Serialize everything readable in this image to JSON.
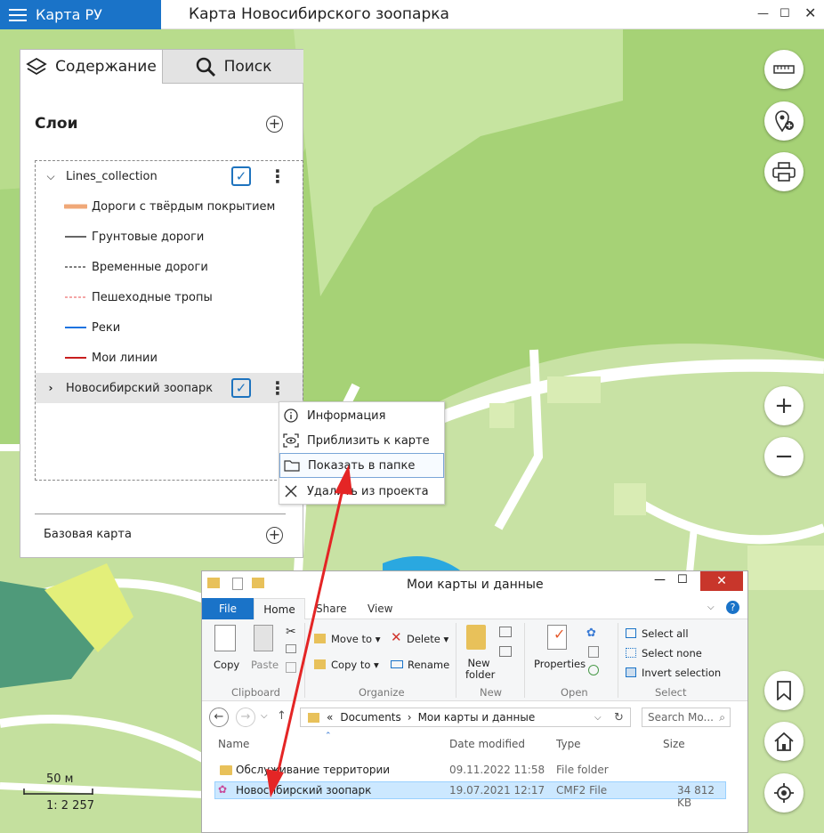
{
  "app": {
    "brand": "Карта РУ",
    "title": "Карта Новосибирского зоопарка"
  },
  "panel": {
    "tabs": [
      {
        "label": "Содержание"
      },
      {
        "label": "Поиск"
      }
    ],
    "layers_title": "Слои",
    "layers": [
      {
        "name": "Lines_collection",
        "checked": true,
        "expanded": true
      },
      {
        "name": "Новосибирский зоопарк",
        "checked": true,
        "expanded": false
      }
    ],
    "legend": [
      {
        "label": "Дороги с твёрдым покрытием",
        "color": "#f0a878",
        "style": "thick"
      },
      {
        "label": "Грунтовые дороги",
        "color": "#666666",
        "style": "solid"
      },
      {
        "label": "Временные дороги",
        "color": "#555555",
        "style": "dashed"
      },
      {
        "label": "Пешеходные тропы",
        "color": "#f08a8a",
        "style": "dashed"
      },
      {
        "label": "Реки",
        "color": "#1e73e0",
        "style": "solid"
      },
      {
        "label": "Мои линии",
        "color": "#c81e1e",
        "style": "solid"
      }
    ],
    "basemap": "Базовая карта"
  },
  "context_menu": {
    "items": [
      {
        "label": "Информация",
        "icon": "info-icon"
      },
      {
        "label": "Приблизить к карте",
        "icon": "zoom-to-icon"
      },
      {
        "label": "Показать в папке",
        "icon": "folder-icon"
      },
      {
        "label": "Удалить из проекта",
        "icon": "close-icon"
      }
    ]
  },
  "scale": {
    "distance": "50 м",
    "ratio": "1: 2 257"
  },
  "explorer": {
    "title": "Мои карты и данные",
    "tabs": {
      "file": "File",
      "home": "Home",
      "share": "Share",
      "view": "View"
    },
    "ribbon": {
      "copy": "Copy",
      "paste": "Paste",
      "move_to": "Move to",
      "copy_to": "Copy to",
      "delete": "Delete",
      "rename": "Rename",
      "new_folder": "New folder",
      "properties": "Properties",
      "select_all": "Select all",
      "select_none": "Select none",
      "invert_selection": "Invert selection",
      "groups": {
        "clipboard": "Clipboard",
        "organize": "Organize",
        "new": "New",
        "open": "Open",
        "select": "Select"
      }
    },
    "address": {
      "prefix": "«",
      "part1": "Documents",
      "part2": "Мои карты и данные"
    },
    "search_placeholder": "Search Mo...",
    "columns": {
      "name": "Name",
      "date": "Date modified",
      "type": "Type",
      "size": "Size"
    },
    "files": [
      {
        "name": "Обслуживание территории",
        "date": "09.11.2022 11:58",
        "type": "File folder",
        "size": ""
      },
      {
        "name": "Новосибирский зоопарк",
        "date": "19.07.2021 12:17",
        "type": "CMF2 File",
        "size": "34 812 KB"
      }
    ]
  }
}
